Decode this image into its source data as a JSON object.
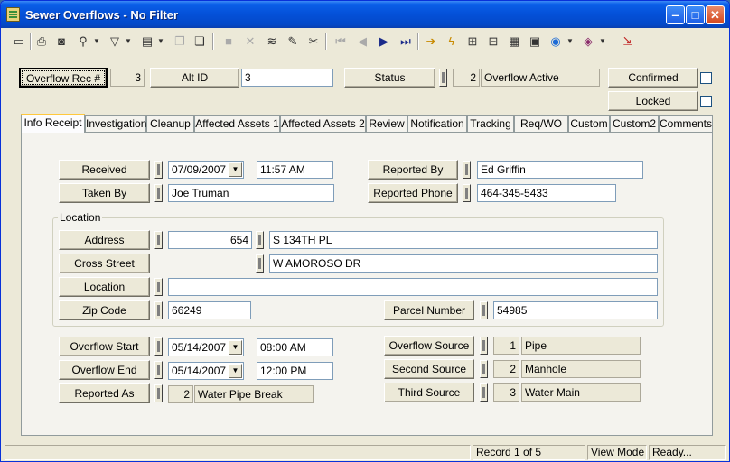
{
  "window": {
    "title": "Sewer Overflows - No Filter"
  },
  "toolbar": {
    "icons": [
      "new-record-icon",
      "print-icon",
      "print-preview-icon",
      "search-icon",
      "filter-icon",
      "report-icon",
      "copy-icon",
      "paste-icon",
      "save-icon",
      "delete-icon",
      "layers-icon",
      "edit-icon",
      "cut-icon",
      "first-record-icon",
      "previous-record-icon",
      "next-record-icon",
      "last-record-icon",
      "go-icon",
      "spell-icon",
      "map-link-icon",
      "gis-icon",
      "chart-icon",
      "calculator-icon",
      "globe-icon",
      "book-icon",
      "exit-icon"
    ]
  },
  "header": {
    "overflow_rec_label": "Overflow Rec #",
    "overflow_rec_value": "3",
    "alt_id_label": "Alt ID",
    "alt_id_value": "3",
    "status_label": "Status",
    "status_code": "2",
    "status_text": "Overflow Active",
    "confirmed_label": "Confirmed",
    "locked_label": "Locked"
  },
  "tabs": [
    {
      "label": "Info Receipt",
      "active": true
    },
    {
      "label": "Investigation"
    },
    {
      "label": "Cleanup"
    },
    {
      "label": "Affected Assets 1"
    },
    {
      "label": "Affected Assets 2"
    },
    {
      "label": "Review"
    },
    {
      "label": "Notification"
    },
    {
      "label": "Tracking"
    },
    {
      "label": "Req/WO"
    },
    {
      "label": "Custom"
    },
    {
      "label": "Custom2"
    },
    {
      "label": "Comments"
    }
  ],
  "receipt": {
    "received_label": "Received",
    "received_date": "07/09/2007",
    "received_time": "11:57 AM",
    "taken_by_label": "Taken By",
    "taken_by": "Joe Truman",
    "reported_by_label": "Reported By",
    "reported_by": "Ed Griffin",
    "reported_phone_label": "Reported Phone",
    "reported_phone": "464-345-5433"
  },
  "location": {
    "group_label": "Location",
    "address_label": "Address",
    "address_number": "654",
    "address_street": "S 134TH PL",
    "cross_street_label": "Cross Street",
    "cross_street": "W AMOROSO DR",
    "location_label": "Location",
    "location_value": "",
    "zip_label": "Zip Code",
    "zip": "66249",
    "parcel_label": "Parcel Number",
    "parcel": "54985"
  },
  "overflow": {
    "start_label": "Overflow Start",
    "start_date": "05/14/2007",
    "start_time": "08:00 AM",
    "end_label": "Overflow End",
    "end_date": "05/14/2007",
    "end_time": "12:00 PM",
    "reported_as_label": "Reported As",
    "reported_as_code": "2",
    "reported_as_text": "Water Pipe Break",
    "source_label": "Overflow Source",
    "source_code": "1",
    "source_text": "Pipe",
    "second_label": "Second Source",
    "second_code": "2",
    "second_text": "Manhole",
    "third_label": "Third Source",
    "third_code": "3",
    "third_text": "Water Main"
  },
  "status": {
    "record": "Record 1 of 5",
    "mode": "View Mode",
    "ready": "Ready..."
  }
}
